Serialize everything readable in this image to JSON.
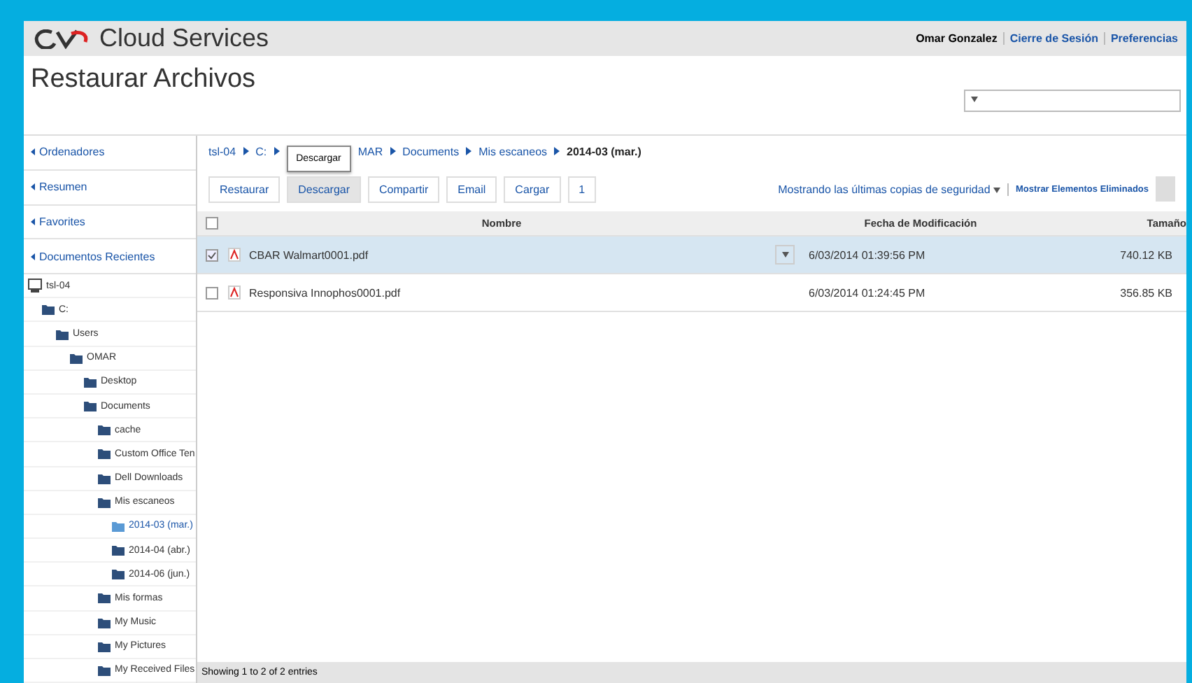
{
  "header": {
    "brand": "Cloud Services",
    "user": "Omar Gonzalez",
    "links": [
      "Cierre de Sesión",
      "Preferencias"
    ]
  },
  "page_title": "Restaurar Archivos",
  "sidebar": {
    "nav": [
      "Ordenadores",
      "Resumen",
      "Favorites",
      "Documentos Recientes"
    ],
    "tree": [
      {
        "label": "tsl-04",
        "kind": "computer",
        "selected": false,
        "children": [
          {
            "label": "C:",
            "kind": "folder",
            "selected": false,
            "children": [
              {
                "label": "Users",
                "kind": "folder",
                "selected": false,
                "children": [
                  {
                    "label": "OMAR",
                    "kind": "folder",
                    "selected": false,
                    "children": [
                      {
                        "label": "Desktop",
                        "kind": "folder",
                        "selected": false
                      },
                      {
                        "label": "Documents",
                        "kind": "folder",
                        "selected": false,
                        "children": [
                          {
                            "label": "cache",
                            "kind": "folder",
                            "selected": false
                          },
                          {
                            "label": "Custom Office Ten",
                            "kind": "folder",
                            "selected": false
                          },
                          {
                            "label": "Dell Downloads",
                            "kind": "folder",
                            "selected": false
                          },
                          {
                            "label": "Mis escaneos",
                            "kind": "folder",
                            "selected": false,
                            "children": [
                              {
                                "label": "2014-03 (mar.)",
                                "kind": "folder",
                                "selected": true
                              },
                              {
                                "label": "2014-04 (abr.)",
                                "kind": "folder",
                                "selected": false
                              },
                              {
                                "label": "2014-06 (jun.)",
                                "kind": "folder",
                                "selected": false
                              }
                            ]
                          },
                          {
                            "label": "Mis formas",
                            "kind": "folder",
                            "selected": false
                          },
                          {
                            "label": "My Music",
                            "kind": "folder",
                            "selected": false
                          },
                          {
                            "label": "My Pictures",
                            "kind": "folder",
                            "selected": false
                          },
                          {
                            "label": "My Received Files",
                            "kind": "folder",
                            "selected": false
                          }
                        ]
                      }
                    ]
                  }
                ]
              }
            ]
          }
        ]
      }
    ]
  },
  "breadcrumb_start": [
    "tsl-04",
    "C:"
  ],
  "tooltip": "Descargar",
  "breadcrumb_end": [
    "MAR",
    "Documents",
    "Mis escaneos",
    "2014-03 (mar.)"
  ],
  "toolbar": [
    {
      "label": "Restaurar",
      "selected": false
    },
    {
      "label": "Descargar",
      "selected": true
    },
    {
      "label": "Compartir",
      "selected": false
    },
    {
      "label": "Email",
      "selected": false
    },
    {
      "label": "Cargar",
      "selected": false
    },
    {
      "label": "1",
      "selected": false
    }
  ],
  "backup_filter": "Mostrando las últimas copias de seguridad",
  "show_deleted": "Mostrar Elementos Eliminados",
  "table": {
    "all_checked": false,
    "columns": [
      "Nombre",
      "Fecha de Modificación",
      "Tamaño"
    ],
    "rows": [
      {
        "name": "CBAR Walmart0001.pdf",
        "date": "6/03/2014 01:39:56 PM",
        "size": "740.12 KB",
        "checked": true,
        "selected": true
      },
      {
        "name": "Responsiva Innophos0001.pdf",
        "date": "6/03/2014 01:24:45 PM",
        "size": "356.85 KB",
        "checked": false,
        "selected": false
      }
    ]
  },
  "footer": "Showing 1 to 2 of 2 entries"
}
